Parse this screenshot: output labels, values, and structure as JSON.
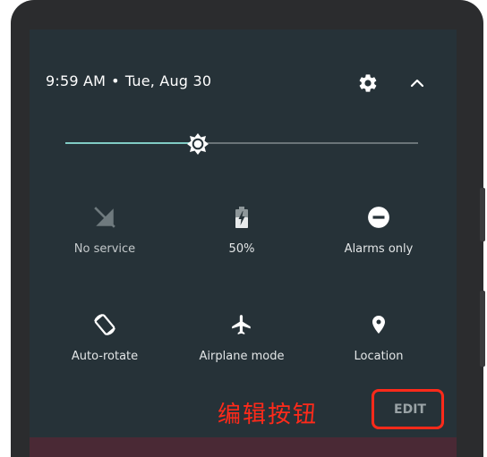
{
  "status": {
    "time": "9:59 AM",
    "separator": "•",
    "date": "Tue, Aug 30"
  },
  "brightness": {
    "level_fraction": 0.375
  },
  "tiles": [
    {
      "label": "No service",
      "icon": "no-service-icon",
      "state": "disabled"
    },
    {
      "label": "50%",
      "icon": "battery-charging-icon",
      "state": "active"
    },
    {
      "label": "Alarms only",
      "icon": "do-not-disturb-icon",
      "state": "active"
    },
    {
      "label": "Auto-rotate",
      "icon": "auto-rotate-icon",
      "state": "active"
    },
    {
      "label": "Airplane mode",
      "icon": "airplane-icon",
      "state": "active"
    },
    {
      "label": "Location",
      "icon": "location-pin-icon",
      "state": "active"
    }
  ],
  "edit_label": "EDIT",
  "annotation_text": "编辑按钮",
  "colors": {
    "panel_bg": "#263238",
    "accent": "#80cbc4",
    "annotation": "#ff2a1a"
  }
}
